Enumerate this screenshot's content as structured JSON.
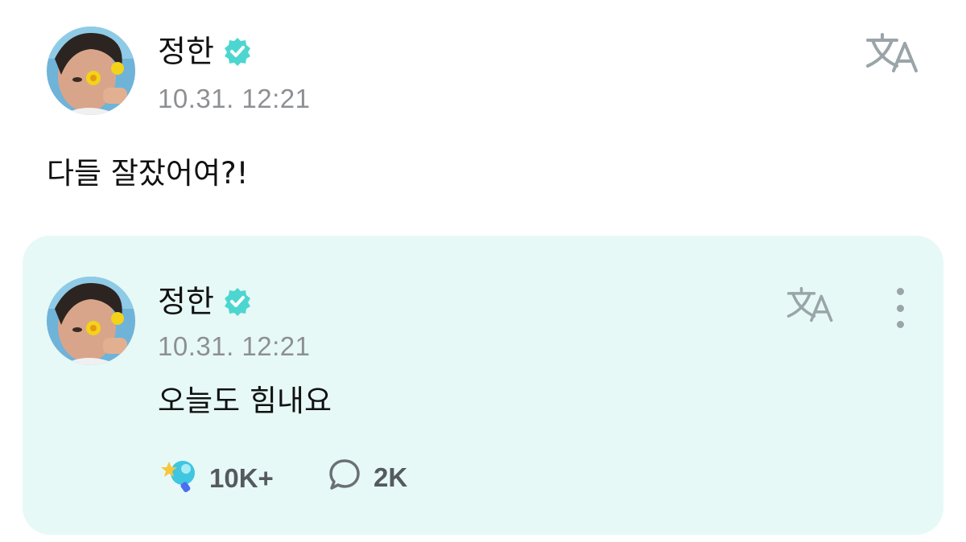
{
  "post": {
    "author": "정한",
    "timestamp": "10.31. 12:21",
    "text": "다들 잘잤어여?!",
    "translate_icon": "translate-icon",
    "verified_icon": "verified-badge-icon"
  },
  "comment": {
    "author": "정한",
    "timestamp": "10.31. 12:21",
    "text": "오늘도 힘내요",
    "likes": "10K+",
    "replies": "2K",
    "like_icon": "cheer-wand-icon",
    "reply_icon": "speech-bubble-icon",
    "more_icon": "more-vertical-icon"
  },
  "colors": {
    "verified": "#4dd6d0",
    "card_bg": "#e6f9f7",
    "timestamp": "#8d8f93",
    "icon_gray": "#9aa5a9"
  }
}
